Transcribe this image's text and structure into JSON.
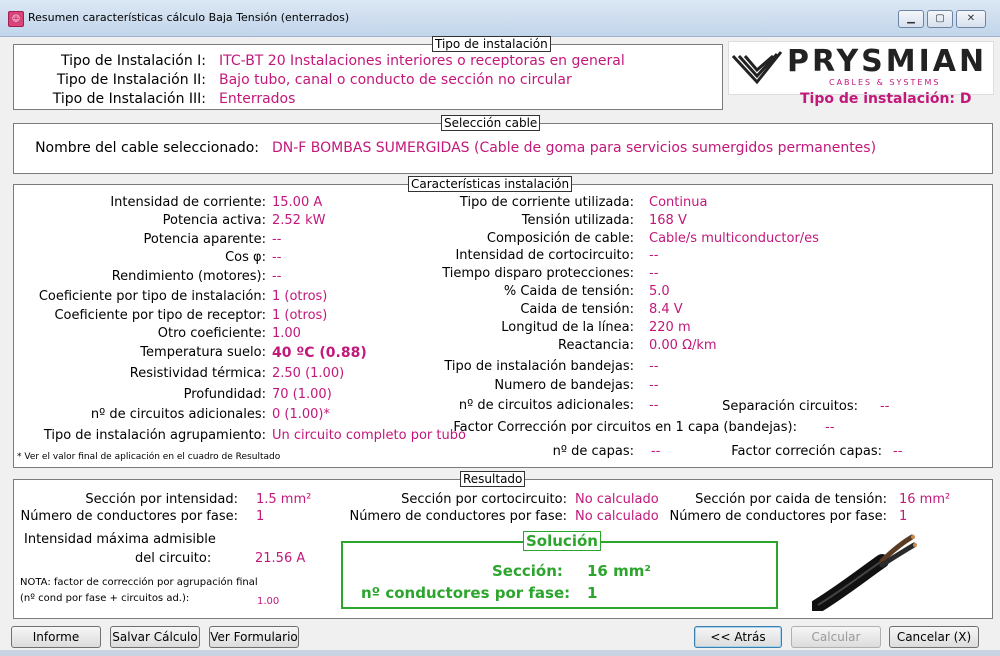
{
  "window": {
    "title": "Resumen características cálculo Baja Tensión (enterrados)"
  },
  "instalacion": {
    "legend": "Tipo de instalación",
    "rows": [
      {
        "label": "Tipo de Instalación I:",
        "value": "ITC-BT 20 Instalaciones interiores o receptoras en general"
      },
      {
        "label": "Tipo de Instalación II:",
        "value": "Bajo tubo, canal o conducto de sección no circular"
      },
      {
        "label": "Tipo de Instalación III:",
        "value": "Enterrados"
      }
    ],
    "logo": "PRYSMIAN",
    "logo_sub": "CABLES & SYSTEMS",
    "tipo_d": "Tipo de instalación: D"
  },
  "seleccion": {
    "legend": "Selección cable",
    "label": "Nombre del cable seleccionado:",
    "value": "DN-F BOMBAS SUMERGIDAS (Cable de goma para servicios sumergidos permanentes)"
  },
  "caracteristicas": {
    "legend": "Características instalación",
    "left": [
      {
        "label": "Intensidad de corriente:",
        "value": "15.00 A"
      },
      {
        "label": "Potencia activa:",
        "value": "2.52 kW"
      },
      {
        "label": "Potencia aparente:",
        "value": "--"
      },
      {
        "label": "Cos φ:",
        "value": "--"
      },
      {
        "label": "Rendimiento (motores):",
        "value": "--"
      },
      {
        "label": "Coeficiente por tipo de instalación:",
        "value": "1 (otros)"
      },
      {
        "label": "Coeficiente por tipo de receptor:",
        "value": "1 (otros)"
      },
      {
        "label": "Otro coeficiente:",
        "value": "1.00"
      },
      {
        "label": "Temperatura suelo:",
        "value": "40 ºC (0.88)"
      },
      {
        "label": "Resistividad térmica:",
        "value": "2.50 (1.00)"
      },
      {
        "label": "Profundidad:",
        "value": "70 (1.00)"
      },
      {
        "label": "nº de circuitos adicionales:",
        "value": "0 (1.00)*"
      },
      {
        "label": "Tipo de instalación agrupamiento:",
        "value": "Un circuito completo por tubo"
      }
    ],
    "right": [
      {
        "label": "Tipo de corriente utilizada:",
        "value": "Continua"
      },
      {
        "label": "Tensión utilizada:",
        "value": "168 V"
      },
      {
        "label": "Composición de cable:",
        "value": "Cable/s multiconductor/es"
      },
      {
        "label": "Intensidad de cortocircuito:",
        "value": "--"
      },
      {
        "label": "Tiempo disparo protecciones:",
        "value": "--"
      },
      {
        "label": "% Caida de tensión:",
        "value": "5.0"
      },
      {
        "label": "Caida de tensión:",
        "value": "8.4 V"
      },
      {
        "label": "Longitud de la línea:",
        "value": "220 m"
      },
      {
        "label": "Reactancia:",
        "value": "0.00 Ω/km"
      },
      {
        "label": "Tipo de instalación bandejas:",
        "value": "--"
      },
      {
        "label": "Numero de bandejas:",
        "value": "--"
      },
      {
        "label": "nº de circuitos adicionales:",
        "value": "--"
      }
    ],
    "separacion": {
      "label": "Separación circuitos:",
      "value": "--"
    },
    "factor_capa": {
      "label": "Factor Corrección por circuitos en 1 capa (bandejas):",
      "value": "--"
    },
    "capas": {
      "label": "nº de capas:",
      "value": "--"
    },
    "factor_capas": {
      "label": "Factor correción capas:",
      "value": "--"
    },
    "footnote": "* Ver el valor final de aplicación en el cuadro de Resultado"
  },
  "resultado": {
    "legend": "Resultado",
    "seccion_intensidad": {
      "label": "Sección por intensidad:",
      "value": "1.5 mm²"
    },
    "cond_fase_1": {
      "label": "Número de conductores por fase:",
      "value": "1"
    },
    "seccion_cortocircuito": {
      "label": "Sección por cortocircuito:",
      "value": "No calculado"
    },
    "cond_fase_2": {
      "label": "Número de conductores por fase:",
      "value": "No calculado"
    },
    "seccion_caida": {
      "label": "Sección por caida de tensión:",
      "value": "16 mm²"
    },
    "cond_fase_3": {
      "label": "Número de conductores por fase:",
      "value": "1"
    },
    "intensidad_max_1": "Intensidad máxima admisible",
    "intensidad_max_2": "del circuito:",
    "intensidad_max_value": "21.56 A",
    "nota_1": "NOTA: factor de corrección por agrupación final",
    "nota_2": "(nº cond por fase + circuitos ad.):",
    "nota_value": "1.00",
    "solucion": {
      "title": "Solución",
      "seccion_label": "Sección:",
      "seccion_value": "16 mm²",
      "cond_label": "nº conductores por fase:",
      "cond_value": "1"
    }
  },
  "buttons": {
    "informe": "Informe",
    "salvar": "Salvar Cálculo",
    "formulario": "Ver Formulario",
    "atras": "<< Atrás",
    "calcular": "Calcular",
    "cancelar": "Cancelar (X)"
  },
  "colors": {
    "value": "#c2187a",
    "solution": "#2ba52b"
  }
}
